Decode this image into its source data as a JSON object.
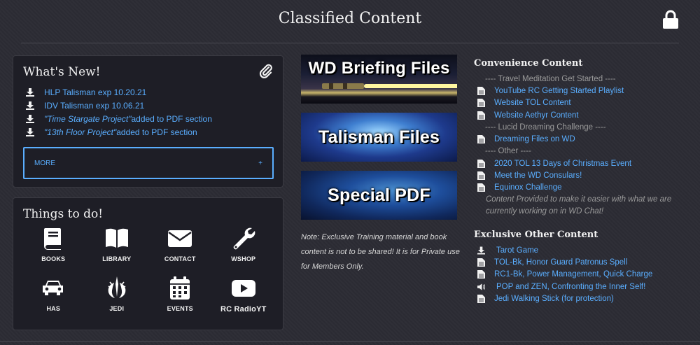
{
  "page": {
    "title": "Classified Content",
    "lock_icon": "lock-icon"
  },
  "whats_new": {
    "heading": "What's New!",
    "icon": "paperclip-icon",
    "items": [
      {
        "icon": "download-icon",
        "link": "HLP Talisman exp 10.20.21",
        "italic": "",
        "rest": ""
      },
      {
        "icon": "download-icon",
        "link": "IDV Talisman exp 10.06.21",
        "italic": "",
        "rest": ""
      },
      {
        "icon": "download-icon",
        "link": "",
        "italic": "\"Time Stargate Project\"",
        "rest": " added to PDF section"
      },
      {
        "icon": "download-icon",
        "link": "",
        "italic": "\"13th Floor Project\"",
        "rest": " added to PDF section"
      }
    ],
    "more_label": "MORE",
    "more_plus": "+"
  },
  "todo": {
    "heading": "Things to do!",
    "items": [
      {
        "label": "BOOKS",
        "icon": "book-icon"
      },
      {
        "label": "LIBRARY",
        "icon": "open-book-icon"
      },
      {
        "label": "CONTACT",
        "icon": "envelope-icon"
      },
      {
        "label": "WSHOP",
        "icon": "wrench-icon"
      },
      {
        "label": "HAS",
        "icon": "car-icon"
      },
      {
        "label": "JEDI",
        "icon": "jedi-order-icon"
      },
      {
        "label": "EVENTS",
        "icon": "calendar-icon"
      },
      {
        "label": "RC RadioYT",
        "icon": "youtube-play-icon"
      }
    ]
  },
  "banners": {
    "wd": "WD Briefing Files",
    "talisman": "Talisman Files",
    "special": "Special PDF"
  },
  "note": "Note: Exclusive Training material and book content is not to be shared! It is for Private use for Members Only.",
  "convenience": {
    "heading": "Convenience Content",
    "items": [
      {
        "type": "sep",
        "text": "---- Travel Meditation Get Started ----"
      },
      {
        "type": "link",
        "icon": "file-icon",
        "text": "YouTube RC Getting Started Playlist"
      },
      {
        "type": "link",
        "icon": "file-icon",
        "text": "Website TOL Content"
      },
      {
        "type": "link",
        "icon": "file-icon",
        "text": "Website Aethyr Content"
      },
      {
        "type": "sep",
        "text": "---- Lucid Dreaming Challenge ----"
      },
      {
        "type": "link",
        "icon": "file-icon",
        "text": "Dreaming Files on WD"
      },
      {
        "type": "sep",
        "text": "---- Other ----"
      },
      {
        "type": "link",
        "icon": "file-icon",
        "text": "2020 TOL 13 Days of Christmas Event"
      },
      {
        "type": "link",
        "icon": "file-icon",
        "text": "Meet the WD Consulars!"
      },
      {
        "type": "link",
        "icon": "file-icon",
        "text": "Equinox Challenge"
      }
    ],
    "provided": "Content Provided to make it easier with what we are currently working on in WD Chat!"
  },
  "exclusive": {
    "heading": "Exclusive Other Content",
    "items": [
      {
        "icon": "download-icon",
        "text": "Tarot Game"
      },
      {
        "icon": "file-icon",
        "text": "TOL-Bk, Honor Guard Patronus Spell"
      },
      {
        "icon": "file-icon",
        "text": "RC1-Bk, Power Management, Quick Charge"
      },
      {
        "icon": "volume-icon",
        "text": "POP and ZEN, Confronting the Inner Self!"
      },
      {
        "icon": "file-icon",
        "text": "Jedi Walking Stick (for protection)"
      }
    ]
  }
}
